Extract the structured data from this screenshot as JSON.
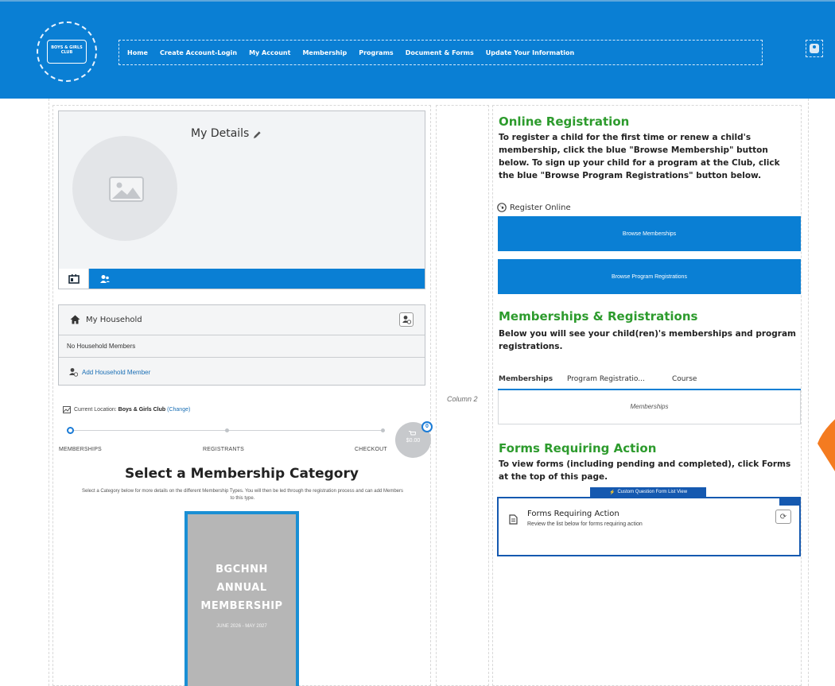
{
  "header": {
    "logo_text": "BOYS & GIRLS CLUB",
    "nav": [
      "Home",
      "Create Account-Login",
      "My Account",
      "Membership",
      "Programs",
      "Document & Forms",
      "Update Your Information"
    ]
  },
  "details": {
    "title": "My Details"
  },
  "household": {
    "title": "My Household",
    "empty_text": "No Household Members",
    "add_link": "Add Household Member"
  },
  "location": {
    "prefix": "Current Location:",
    "name": "Boys & Girls Club",
    "change": "(Change)"
  },
  "steps": {
    "labels": [
      "MEMBERSHIPS",
      "REGISTRANTS",
      "CHECKOUT"
    ],
    "cart_total": "$0.00",
    "cart_count": "0"
  },
  "membership_select": {
    "title": "Select a Membership Category",
    "description": "Select a Category below for more details on the different Membership Types. You will then be led through the registration process and can add Members to this type.",
    "tile_lines": [
      "BGCHNH",
      "ANNUAL",
      "MEMBERSHIP"
    ],
    "tile_sub": "JUNE 2026 - MAY 2027"
  },
  "column2_label": "Column 2",
  "online_registration": {
    "title": "Online Registration",
    "text": "To register a child for the first time or renew a child's membership, click the blue \"Browse Membership\" button below. To sign up your child for a program at the Club, click the blue \"Browse Program Registrations\" button below.",
    "register_label": "Register Online",
    "browse_memberships": "Browse Memberships",
    "browse_programs": "Browse Program Registrations"
  },
  "memberships_registrations": {
    "title": "Memberships & Registrations",
    "text": "Below you will see your child(ren)'s memberships and program registrations.",
    "tabs": [
      "Memberships",
      "Program Registratio...",
      "Course"
    ],
    "panel_text": "Memberships"
  },
  "forms": {
    "title": "Forms Requiring  Action",
    "text": "To view forms (including pending and completed), click Forms at the top of this page.",
    "component_label": "Custom Question Form List View",
    "card_title": "Forms Requiring Action",
    "card_sub": "Review the list below for forms requiring action"
  },
  "colors": {
    "brand_blue": "#0a7fd4",
    "heading_green": "#2d9b2d",
    "accent_orange": "#f47b20"
  }
}
